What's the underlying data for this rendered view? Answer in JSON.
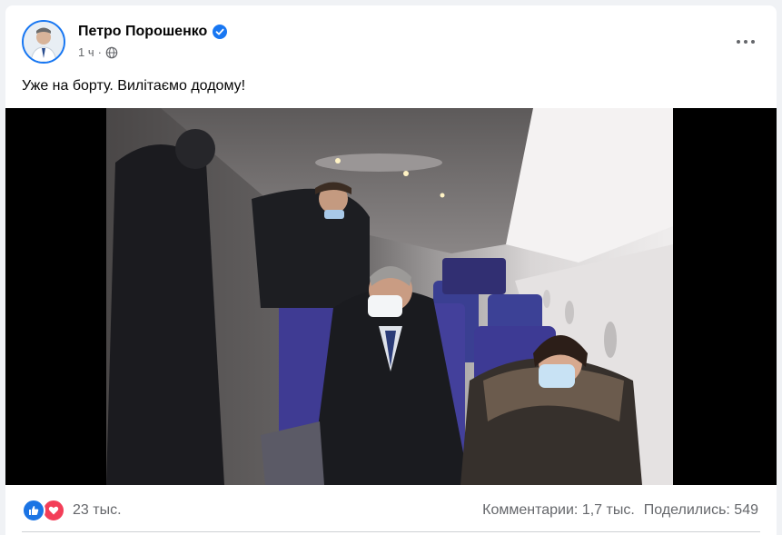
{
  "post": {
    "author": "Петро Порошенко",
    "verified_icon": "verified-badge-icon",
    "time": "1 ч",
    "audience_icon": "globe-icon",
    "text": "Уже на борту. Вилітаємо додому!"
  },
  "footer": {
    "reaction_icons": [
      "like-icon",
      "love-icon"
    ],
    "reaction_count": "23 тыс.",
    "comments": "Комментарии: 1,7 тыс.",
    "shares": "Поделились: 549"
  },
  "colors": {
    "accent": "#1877f2",
    "like": "#1b74e4",
    "love": "#f33e58",
    "secondary_text": "#65676b"
  }
}
